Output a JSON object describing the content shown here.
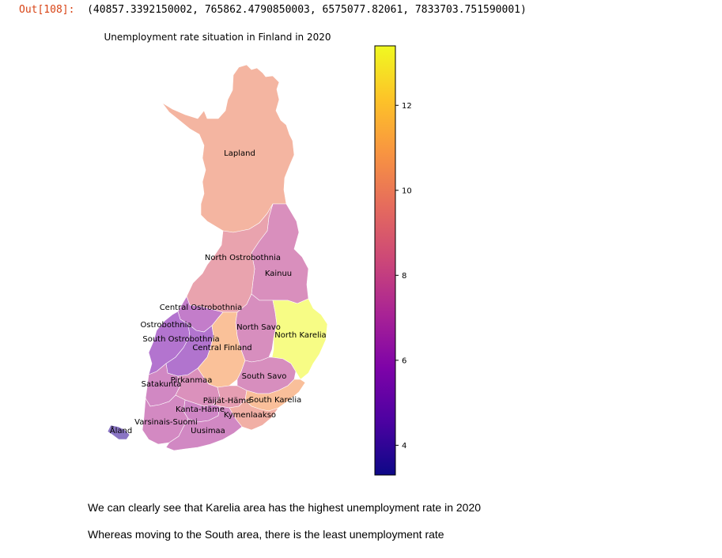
{
  "cell": {
    "prompt": "Out[108]:",
    "value": "(40857.3392150002, 765862.4790850003, 6575077.82061, 7833703.751590001)"
  },
  "chart_data": {
    "type": "choropleth",
    "title": "Unemployment rate situation in Finland in 2020",
    "colormap": "plasma",
    "colorbar": {
      "vmin": 3.3,
      "vmax": 13.4,
      "ticks": [
        4,
        6,
        8,
        10,
        12
      ]
    },
    "regions": [
      {
        "name": "Lapland",
        "value": 10.0
      },
      {
        "name": "North Ostrobothnia",
        "value": 8.9
      },
      {
        "name": "Kainuu",
        "value": 7.7
      },
      {
        "name": "Central Ostrobothnia",
        "value": 6.4
      },
      {
        "name": "Ostrobothnia",
        "value": 5.6
      },
      {
        "name": "South Ostrobothnia",
        "value": 5.5
      },
      {
        "name": "Central Finland",
        "value": 10.7
      },
      {
        "name": "North Savo",
        "value": 7.6
      },
      {
        "name": "North Karelia",
        "value": 13.4
      },
      {
        "name": "South Savo",
        "value": 7.6
      },
      {
        "name": "Satakunta",
        "value": 7.2
      },
      {
        "name": "Pirkanmaa",
        "value": 7.8
      },
      {
        "name": "Päijät-Häme",
        "value": 8.6
      },
      {
        "name": "South Karelia",
        "value": 10.6
      },
      {
        "name": "Kanta-Häme",
        "value": 7.0
      },
      {
        "name": "Kymenlaakso",
        "value": 9.7
      },
      {
        "name": "Varsinais-Suomi",
        "value": 7.3
      },
      {
        "name": "Uusimaa",
        "value": 7.2
      },
      {
        "name": "Åland",
        "value": 3.9
      }
    ]
  },
  "notes": [
    "We can clearly see that Karelia area has the highest unemployment rate in 2020",
    "Whereas moving to the South area, there is the least unemployment rate"
  ]
}
